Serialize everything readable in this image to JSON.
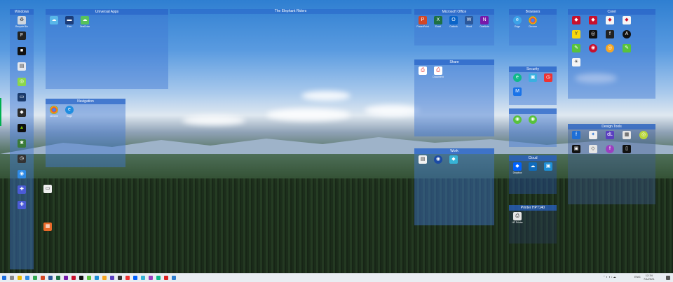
{
  "desktop": {
    "banner_title": "The Elephant Riders"
  },
  "fences": {
    "windows": {
      "title": "Windows",
      "items": [
        "Recycle Bin",
        "",
        "",
        "",
        "",
        "",
        "",
        "",
        "",
        "",
        "",
        "",
        "",
        "",
        "",
        ""
      ]
    },
    "universal": {
      "title": "Universal Apps",
      "items": [
        "",
        "Elen",
        "OneDrive"
      ]
    },
    "navigation": {
      "title": "Navigation",
      "items": [
        "Chrome",
        "Edge"
      ]
    },
    "office": {
      "title": "Microsoft Office",
      "items": [
        "PowerPoint",
        "Excel",
        "Outlook",
        "Word",
        "OneNote"
      ]
    },
    "shared": {
      "title": "Share",
      "items": [
        "",
        "Document"
      ]
    },
    "work": {
      "title": "Work",
      "items": [
        "",
        "",
        ""
      ]
    },
    "browsers": {
      "title": "Browsers",
      "items": [
        "Edge",
        "Chrome"
      ]
    },
    "security": {
      "title": "Security",
      "items": [
        "",
        "",
        ""
      ]
    },
    "cloud": {
      "title": "Cloud",
      "items": [
        "Dropbox",
        "",
        ""
      ]
    },
    "printer": {
      "title": "Printer HP7140",
      "items": [
        "HP Printer"
      ]
    },
    "corel": {
      "title": "Corel",
      "items": [
        "",
        "",
        "",
        "",
        "",
        "",
        "",
        "",
        "",
        "",
        "",
        "",
        "",
        "",
        "",
        ""
      ]
    },
    "design": {
      "title": "Design Tools",
      "items": [
        "",
        "",
        "",
        "",
        "",
        "",
        "",
        ""
      ]
    },
    "misc_left": {
      "items": [
        "",
        ""
      ]
    }
  },
  "taskbar": {
    "time": "12:34",
    "date": "7/1/2021",
    "language": "ENG"
  }
}
